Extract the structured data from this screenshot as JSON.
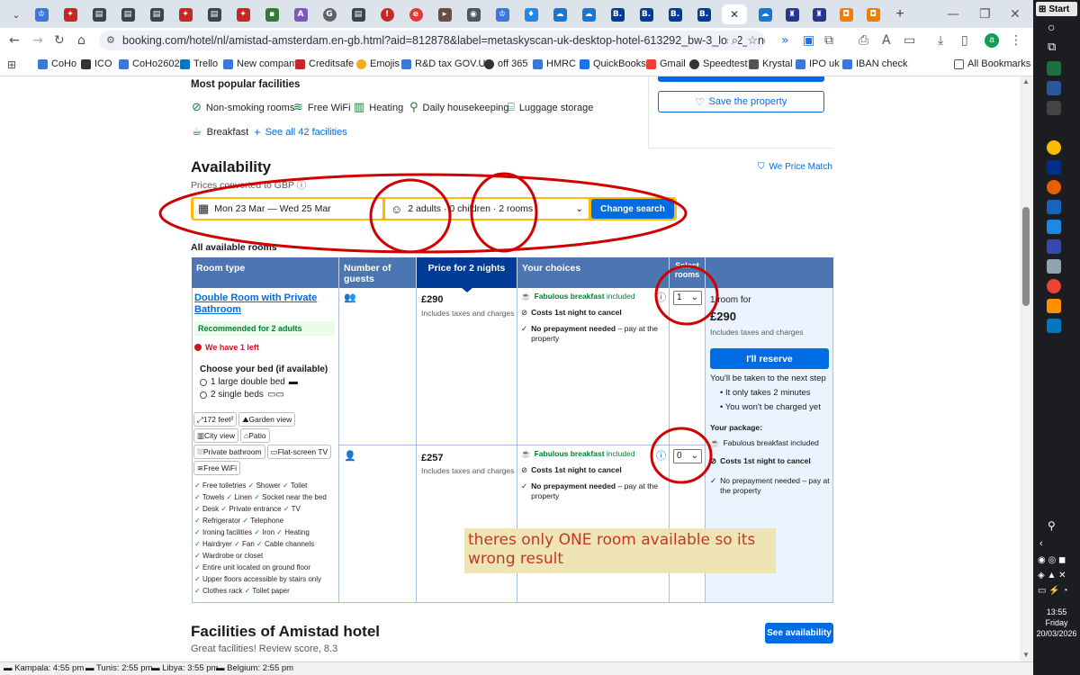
{
  "browser": {
    "url": "booking.com/hotel/nl/amistad-amsterdam.en-gb.html?aid=812878&label=metaskyscan-uk-desktop-hotel-613292_bw-3_los-2_lang-en_curr-GBP_g...",
    "profile_initial": "a",
    "bookmarks": [
      "CoHo",
      "ICO",
      "CoHo2602",
      "Trello",
      "New company",
      "Creditsafe",
      "Emojis",
      "R&D tax GOV.UK",
      "off 365",
      "HMRC",
      "QuickBooks",
      "Gmail",
      "Speedtest",
      "Krystal",
      "IPO uk",
      "IBAN check"
    ],
    "all_bookmarks": "All Bookmarks"
  },
  "page": {
    "popular_facilities_title": "Most popular facilities",
    "facilities": [
      "Non-smoking rooms",
      "Free WiFi",
      "Heating",
      "Daily housekeeping",
      "Luggage storage",
      "Breakfast"
    ],
    "see_all": "See all 42 facilities",
    "save_property": "Save the property",
    "availability_title": "Availability",
    "we_price_match": "We Price Match",
    "prices_converted": "Prices converted to GBP",
    "dates": "Mon 23 Mar  —  Wed 25 Mar",
    "guests": "2 adults · 0 children · 2 rooms",
    "change_search": "Change search",
    "all_available_rooms": "All available rooms",
    "table_headers": [
      "Room type",
      "Number of guests",
      "Price for 2 nights",
      "Your choices",
      "Select rooms"
    ],
    "room_name": "Double Room with Private Bathroom",
    "recommended": "Recommended for 2 adults",
    "we_have_left": "We have 1 left",
    "choose_bed": "Choose your bed (if available)",
    "bed_options": [
      "1 large double bed",
      "2 single beds"
    ],
    "features": [
      "172 feet²",
      "Garden view",
      "City view",
      "Patio",
      "Private bathroom",
      "Flat-screen TV",
      "Free WiFi"
    ],
    "amenities": [
      [
        "Free toiletries",
        "Shower",
        "Toilet"
      ],
      [
        "Towels",
        "Linen",
        "Socket near the bed"
      ],
      [
        "Desk",
        "Private entrance",
        "TV"
      ],
      [
        "Refrigerator",
        "Telephone"
      ],
      [
        "Ironing facilities",
        "Iron",
        "Heating"
      ],
      [
        "Hairdryer",
        "Fan",
        "Cable channels"
      ],
      [
        "Wardrobe or closet"
      ],
      [
        "Entire unit located on ground floor"
      ],
      [
        "Upper floors accessible by stairs only"
      ],
      [
        "Clothes rack",
        "Toilet paper"
      ]
    ],
    "options": [
      {
        "price": "£290",
        "taxes": "Includes taxes and charges",
        "breakfast": "Fabulous breakfast",
        "included": "included",
        "cancel": "Costs 1st night to cancel",
        "noprepay": "No prepayment needed",
        "paynote": "– pay at the property",
        "selected": "1"
      },
      {
        "price": "£257",
        "taxes": "Includes taxes and charges",
        "breakfast": "Fabulous breakfast",
        "included": "included",
        "cancel": "Costs 1st night to cancel",
        "noprepay": "No prepayment needed",
        "paynote": "– pay at the property",
        "selected": "0"
      }
    ],
    "summary": {
      "rooms_for": "1 room for",
      "total": "£290",
      "taxes": "Includes taxes and charges",
      "reserve": "I'll reserve",
      "next_step": "You'll be taken to the next step",
      "bullets": [
        "It only takes 2 minutes",
        "You won't be charged yet"
      ],
      "package_title": "Your package:",
      "package": [
        "Fabulous breakfast included",
        "Costs 1st night to cancel",
        "No prepayment needed – pay at the property"
      ]
    },
    "facilities_title": "Facilities of Amistad hotel",
    "facilities_sub": "Great facilities! Review score, 8.3",
    "see_availability": "See availability"
  },
  "annotation_note": "theres only ONE room available so its wrong result",
  "status_clocks": [
    "Kampala: 4:55 pm",
    "Tunis: 2:55 pm",
    "Libya: 3:55 pm",
    "Belgium: 2:55 pm"
  ],
  "taskbar": {
    "start": "Start",
    "time": "13:55",
    "day": "Friday",
    "date": "20/03/2026"
  },
  "colors": {
    "annotation": "#d10000",
    "accent": "#006ce4",
    "header": "#4c76b2"
  }
}
